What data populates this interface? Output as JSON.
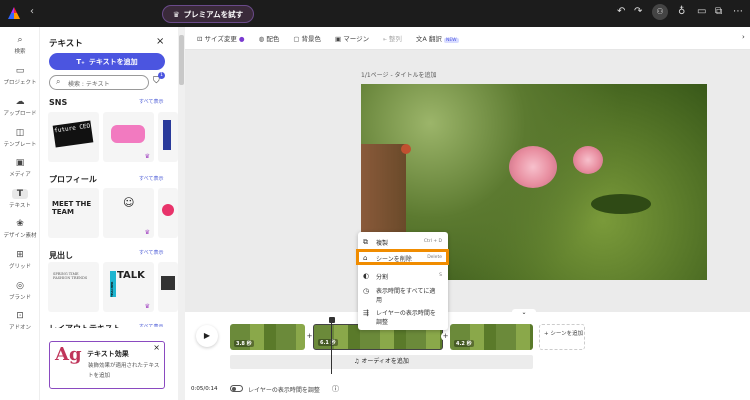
{
  "topbar": {
    "premium_label": "プレミアムを試す",
    "icons": [
      "undo-icon",
      "redo-icon",
      "invite-icon",
      "lightbulb-icon",
      "comment-icon",
      "share-icon",
      "more-icon"
    ]
  },
  "rail": [
    {
      "label": "検索",
      "icon": "⌕"
    },
    {
      "label": "プロジェクト",
      "icon": "▭"
    },
    {
      "label": "アップロード",
      "icon": "☁"
    },
    {
      "label": "テンプレート",
      "icon": "◫"
    },
    {
      "label": "メディア",
      "icon": "▣"
    },
    {
      "label": "テキスト",
      "icon": "T"
    },
    {
      "label": "デザイン素材",
      "icon": "❀"
    },
    {
      "label": "グリッド",
      "icon": "⊞"
    },
    {
      "label": "ブランド",
      "icon": "◎"
    },
    {
      "label": "アドオン",
      "icon": "⊡"
    }
  ],
  "panel": {
    "title": "テキスト",
    "add_text": "テキストを追加",
    "search_placeholder": "検索 : テキスト",
    "filter_badge": "1",
    "see_all": "すべて表示",
    "sections": [
      {
        "title": "SNS"
      },
      {
        "title": "プロフィール"
      },
      {
        "title": "見出し"
      },
      {
        "title": "レイアウトテキスト"
      }
    ],
    "cards": {
      "future": "future CEO",
      "meet": "MEET THE TEAM",
      "talk": "TALK",
      "teacher": "TEACHER",
      "spring": "SPRING TIME FASHION TRENDS"
    },
    "effect": {
      "ag": "Ag",
      "title": "テキスト効果",
      "desc": "装飾効果が適用されたテキストを追加"
    }
  },
  "toolbar": {
    "items": [
      "サイズ変更",
      "配色",
      "背景色",
      "マージン",
      "整列",
      "翻訳"
    ],
    "new_badge": "NEW"
  },
  "canvas": {
    "page_label": "1/1ページ - タイトルを追加"
  },
  "context_menu": {
    "items": [
      {
        "label": "複製",
        "shortcut": "Ctrl + D",
        "icon": "⧉"
      },
      {
        "label": "シーンを削除",
        "shortcut": "Delete",
        "icon": "🗑"
      },
      {
        "label": "分割",
        "shortcut": "S",
        "icon": "◐"
      },
      {
        "label": "表示時間をすべてに適用",
        "icon": "◷"
      },
      {
        "label": "レイヤーの表示時間を調整",
        "icon": "⇶"
      }
    ],
    "highlight_color": "#f08c00"
  },
  "timeline": {
    "clips": [
      "3.8 秒",
      "6.1 秒",
      "4.2 秒"
    ],
    "add_scene": "+ シーンを追加",
    "add_audio": "オーディオを追加",
    "time": "0:05/0:14",
    "toggle_label": "レイヤーの表示時間を調整",
    "toggle_on": false
  }
}
